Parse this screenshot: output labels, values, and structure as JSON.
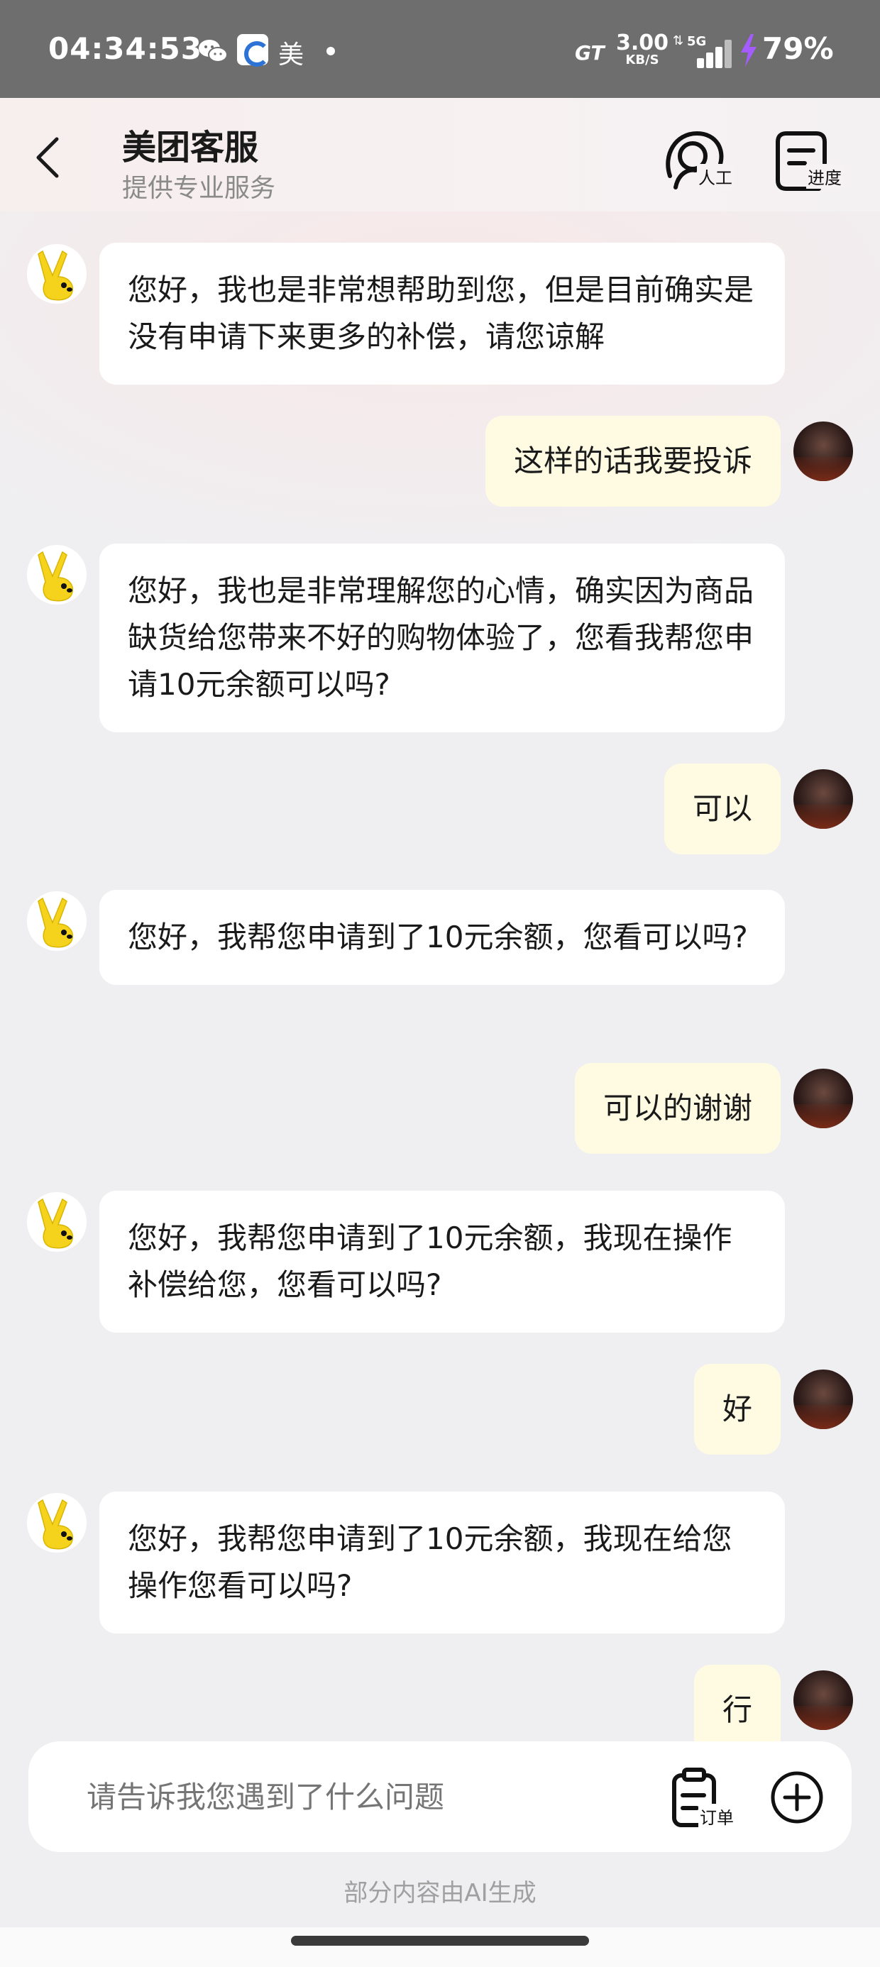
{
  "status_bar": {
    "time": "04:34:53",
    "notif_app_char": "美",
    "network_brand": "GT",
    "speed_value": "3.00",
    "speed_unit": "KB/S",
    "network_type": "5G",
    "battery": "79%"
  },
  "header": {
    "title": "美团客服",
    "subtitle": "提供专业服务",
    "human_label": "人工",
    "progress_label": "进度"
  },
  "messages": [
    {
      "from": "bot",
      "text": "您好，我也是非常想帮助到您，但是目前确实是没有申请下来更多的补偿，请您谅解"
    },
    {
      "from": "user",
      "text": "这样的话我要投诉"
    },
    {
      "from": "bot",
      "text": "您好，我也是非常理解您的心情，确实因为商品缺货给您带来不好的购物体验了，您看我帮您申请10元余额可以吗?"
    },
    {
      "from": "user",
      "text": "可以"
    },
    {
      "from": "bot",
      "text": "您好，我帮您申请到了10元余额，您看可以吗?"
    },
    {
      "from": "user",
      "text": "可以的谢谢"
    },
    {
      "from": "bot",
      "text": "您好，我帮您申请到了10元余额，我现在操作补偿给您，您看可以吗?"
    },
    {
      "from": "user",
      "text": "好"
    },
    {
      "from": "bot",
      "text": "您好，我帮您申请到了10元余额，我现在给您操作您看可以吗?"
    },
    {
      "from": "user",
      "text": "行"
    }
  ],
  "input": {
    "placeholder": "请告诉我您遇到了什么问题",
    "order_label": "订单"
  },
  "footer_note": "部分内容由AI生成",
  "colors": {
    "user_bubble": "#fffbe3",
    "bot_bubble": "#ffffff",
    "background": "#efeff1",
    "mascot_yellow": "#f5d21c"
  }
}
